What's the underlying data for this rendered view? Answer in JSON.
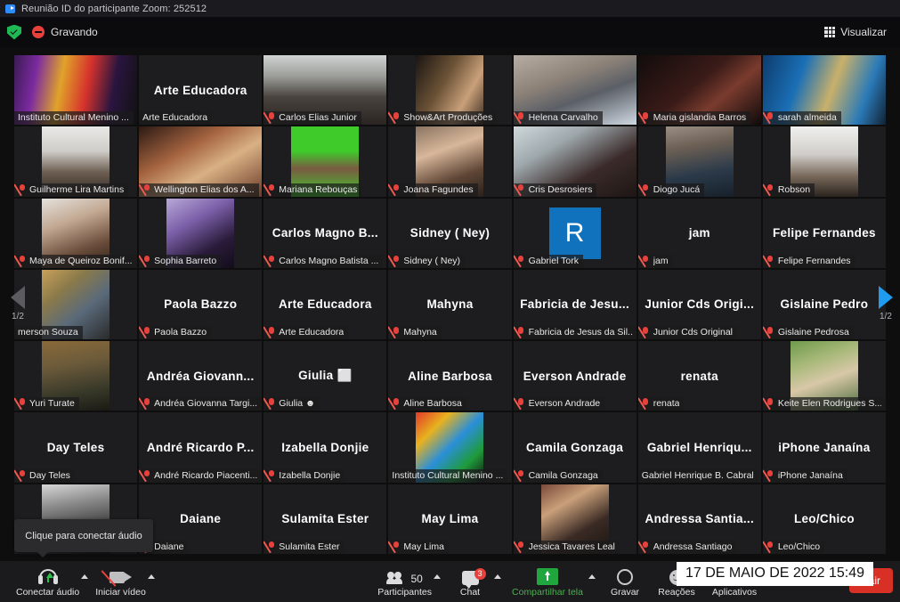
{
  "window": {
    "title": "Reunião ID do participante Zoom: 252512"
  },
  "topbar": {
    "recording_label": "Gravando",
    "view_label": "Visualizar"
  },
  "gallery": {
    "page_indicator_left": "1/2",
    "page_indicator_right": "1/2",
    "tooltip": "Clique para conectar áudio",
    "tiles": [
      {
        "big": "",
        "name": "Instituto Cultural Menino ...",
        "muted": false,
        "video": true,
        "active": true,
        "media": "stage"
      },
      {
        "big": "Arte Educadora",
        "name": "Arte Educadora",
        "muted": false,
        "video": false
      },
      {
        "big": "",
        "name": "Carlos Elias Junior",
        "muted": true,
        "video": true,
        "media": "man-room"
      },
      {
        "big": "",
        "name": "Show&Art Produções",
        "muted": true,
        "video": true,
        "media": "woman-dark"
      },
      {
        "big": "",
        "name": "Helena Carvalho",
        "muted": true,
        "video": true,
        "media": "woman-bed"
      },
      {
        "big": "",
        "name": "Maria gislandia Barros",
        "muted": true,
        "video": true,
        "media": "dark-room"
      },
      {
        "big": "",
        "name": "sarah almeida",
        "muted": true,
        "video": true,
        "media": "blue-event"
      },
      {
        "big": "",
        "name": "Guilherme Lira Martins",
        "muted": true,
        "video": true,
        "media": "man-glasses"
      },
      {
        "big": "",
        "name": "Wellington Elias dos A...",
        "muted": true,
        "video": true,
        "media": "longhair"
      },
      {
        "big": "",
        "name": "Mariana Rebouças",
        "muted": true,
        "video": true,
        "media": "green-screen"
      },
      {
        "big": "",
        "name": "Joana Fagundes",
        "muted": true,
        "video": true,
        "media": "woman-curly"
      },
      {
        "big": "",
        "name": "Cris Desrosiers",
        "muted": true,
        "video": true,
        "media": "woman-glasses"
      },
      {
        "big": "",
        "name": "Diogo Jucá",
        "muted": true,
        "video": true,
        "media": "bearded-man"
      },
      {
        "big": "",
        "name": "Robson",
        "muted": true,
        "video": true,
        "media": "man-white"
      },
      {
        "big": "",
        "name": "Maya de Queiroz Bonif...",
        "muted": true,
        "video": true,
        "media": "woman-short"
      },
      {
        "big": "",
        "name": "Sophia Barreto",
        "muted": true,
        "video": true,
        "media": "purple-art"
      },
      {
        "big": "Carlos Magno B...",
        "name": "Carlos Magno Batista ...",
        "muted": true,
        "video": false
      },
      {
        "big": "Sidney ( Ney)",
        "name": "Sidney ( Ney)",
        "muted": true,
        "video": false
      },
      {
        "big": "",
        "name": "Gabriel Tork",
        "muted": true,
        "video": false,
        "avatar_letter": "R",
        "avatar_color": "#1071bd"
      },
      {
        "big": "jam",
        "name": "jam",
        "muted": true,
        "video": false
      },
      {
        "big": "Felipe Fernandes",
        "name": "Felipe Fernandes",
        "muted": true,
        "video": false
      },
      {
        "big": "",
        "name": "merson Souza",
        "muted": false,
        "video": true,
        "media": "game-art"
      },
      {
        "big": "Paola Bazzo",
        "name": "Paola Bazzo",
        "muted": true,
        "video": false
      },
      {
        "big": "Arte Educadora",
        "name": "Arte Educadora",
        "muted": true,
        "video": false
      },
      {
        "big": "Mahyna",
        "name": "Mahyna",
        "muted": true,
        "video": false
      },
      {
        "big": "Fabricia de Jesu...",
        "name": "Fabricia de Jesus da Sil...",
        "muted": true,
        "video": false
      },
      {
        "big": "Junior Cds Origi...",
        "name": "Junior Cds Original",
        "muted": true,
        "video": false
      },
      {
        "big": "Gislaine Pedro",
        "name": "Gislaine Pedrosa",
        "muted": true,
        "video": false
      },
      {
        "big": "",
        "name": "Yuri Turate",
        "muted": true,
        "video": true,
        "media": "man-olive"
      },
      {
        "big": "Andréa Giovann...",
        "name": "Andréa Giovanna Targi...",
        "muted": true,
        "video": false
      },
      {
        "big": "Giulia ⬜",
        "name": "Giulia ☻",
        "muted": true,
        "video": false
      },
      {
        "big": "Aline Barbosa",
        "name": "Aline Barbosa",
        "muted": true,
        "video": false
      },
      {
        "big": "Everson Andrade",
        "name": "Everson Andrade",
        "muted": true,
        "video": false
      },
      {
        "big": "renata",
        "name": "renata",
        "muted": true,
        "video": false
      },
      {
        "big": "",
        "name": "Keite Elen Rodrigues S...",
        "muted": true,
        "video": true,
        "media": "curly-outdoor"
      },
      {
        "big": "Day Teles",
        "name": "Day Teles",
        "muted": true,
        "video": false
      },
      {
        "big": "André Ricardo P...",
        "name": "André Ricardo Piacenti...",
        "muted": true,
        "video": false
      },
      {
        "big": "Izabella Donjie",
        "name": "Izabella Donjie",
        "muted": true,
        "video": false
      },
      {
        "big": "",
        "name": "Instituto Cultural Menino ...",
        "muted": false,
        "video": true,
        "media": "clown"
      },
      {
        "big": "Camila Gonzaga",
        "name": "Camila Gonzaga",
        "muted": true,
        "video": false
      },
      {
        "big": "Gabriel Henriqu...",
        "name": "Gabriel Henrique B. Cabral",
        "muted": false,
        "video": false
      },
      {
        "big": "iPhone Janaína",
        "name": "iPhone Janaína",
        "muted": true,
        "video": false
      },
      {
        "big": "",
        "name": "",
        "muted": false,
        "video": true,
        "media": "bw-person"
      },
      {
        "big": "Daiane",
        "name": "Daiane",
        "muted": true,
        "video": false
      },
      {
        "big": "Sulamita Ester",
        "name": "Sulamita Ester",
        "muted": true,
        "video": false
      },
      {
        "big": "May Lima",
        "name": "May Lima",
        "muted": true,
        "video": false
      },
      {
        "big": "",
        "name": "Jessica Tavares Leal",
        "muted": true,
        "video": true,
        "media": "woman-drink"
      },
      {
        "big": "Andressa Santia...",
        "name": "Andressa Santiago",
        "muted": true,
        "video": false
      },
      {
        "big": "Leo/Chico",
        "name": "Leo/Chico",
        "muted": true,
        "video": false
      }
    ]
  },
  "toolbar": {
    "audio_label": "Conectar áudio",
    "video_label": "Iniciar vídeo",
    "participants_label": "Participantes",
    "participants_count": "50",
    "chat_label": "Chat",
    "chat_badge": "3",
    "share_label": "Compartilhar tela",
    "record_label": "Gravar",
    "reactions_label": "Reações",
    "apps_label": "Aplicativos",
    "exit_label": "Sair"
  },
  "overlay": {
    "datestamp": "17 DE MAIO DE 2022 15:49"
  },
  "colors": {
    "accent_blue": "#2d8cff",
    "recording_red": "#e8413c",
    "active_border": "#e9ef6e",
    "green": "#21a53f",
    "exit_red": "#d93025"
  }
}
